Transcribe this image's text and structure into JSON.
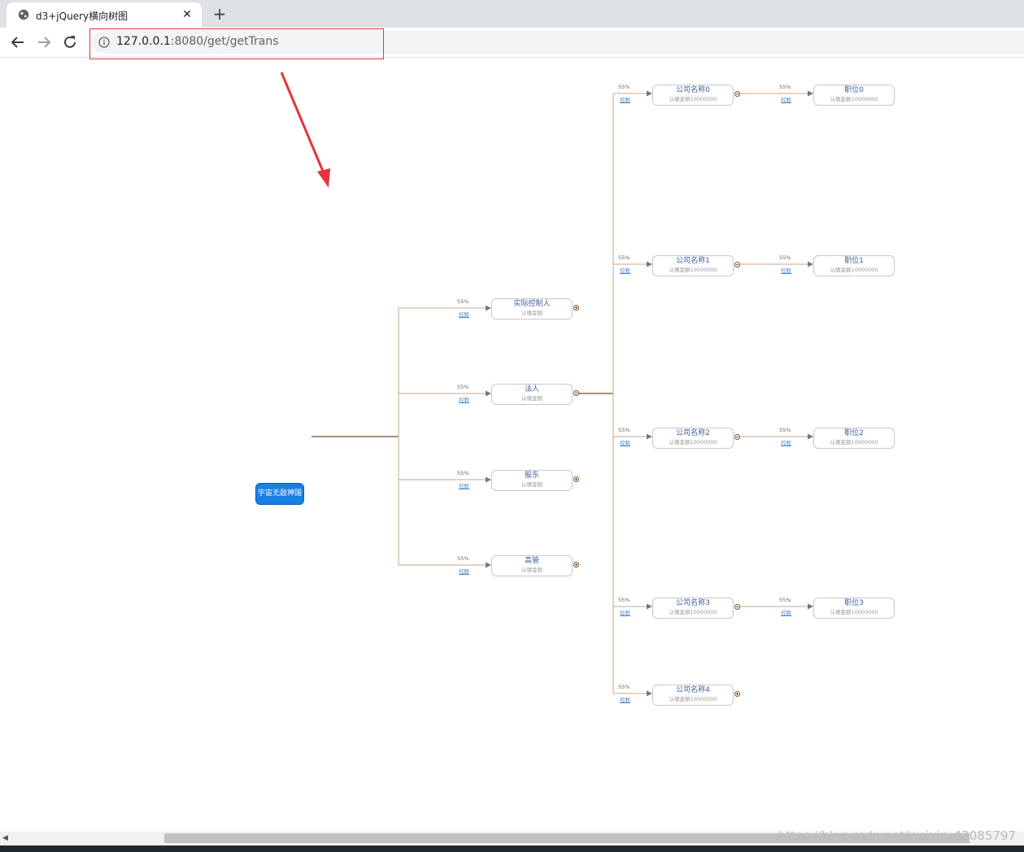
{
  "browser": {
    "tab_title": "d3+jQuery横向树图",
    "tab_close": "✕",
    "new_tab": "+",
    "url_host": "127.0.0.1",
    "url_rest": ":8080/get/getTrans"
  },
  "tree": {
    "root": "宇宙无敌神国",
    "level1": [
      {
        "name": "实际控制人",
        "sub": "认缴金额",
        "pct": "55%",
        "rel": "控股",
        "toggle": "plus"
      },
      {
        "name": "法人",
        "sub": "认缴金额",
        "pct": "55%",
        "rel": "控股",
        "toggle": "minus"
      },
      {
        "name": "股东",
        "sub": "认缴金额",
        "pct": "55%",
        "rel": "控股",
        "toggle": "plus"
      },
      {
        "name": "高管",
        "sub": "认缴金额",
        "pct": "55%",
        "rel": "控股",
        "toggle": "plus"
      }
    ],
    "companies": [
      {
        "name": "公司名称0",
        "sub": "认缴金额10000000",
        "pct": "55%",
        "rel": "控股",
        "toggle": "minus"
      },
      {
        "name": "公司名称1",
        "sub": "认缴金额10000000",
        "pct": "55%",
        "rel": "控股",
        "toggle": "minus"
      },
      {
        "name": "公司名称2",
        "sub": "认缴金额10000000",
        "pct": "55%",
        "rel": "控股",
        "toggle": "minus"
      },
      {
        "name": "公司名称3",
        "sub": "认缴金额10000000",
        "pct": "55%",
        "rel": "控股",
        "toggle": "minus"
      },
      {
        "name": "公司名称4",
        "sub": "认缴金额10000000",
        "pct": "55%",
        "rel": "控股",
        "toggle": "plus"
      }
    ],
    "positions": [
      {
        "name": "职位0",
        "sub": "认缴金额10000000",
        "pct": "55%",
        "rel": "控股"
      },
      {
        "name": "职位1",
        "sub": "认缴金额10000000",
        "pct": "55%",
        "rel": "控股"
      },
      {
        "name": "职位2",
        "sub": "认缴金额10000000",
        "pct": "55%",
        "rel": "控股"
      },
      {
        "name": "职位3",
        "sub": "认缴金额10000000",
        "pct": "55%",
        "rel": "控股"
      }
    ]
  },
  "colors": {
    "root_fill": "#1a7fe3",
    "link": "#c8a88a",
    "link_dark": "#8a6a4a",
    "annotation": "#e8333a"
  },
  "watermark": "https://blog.csdn.net/weixin_43085797"
}
